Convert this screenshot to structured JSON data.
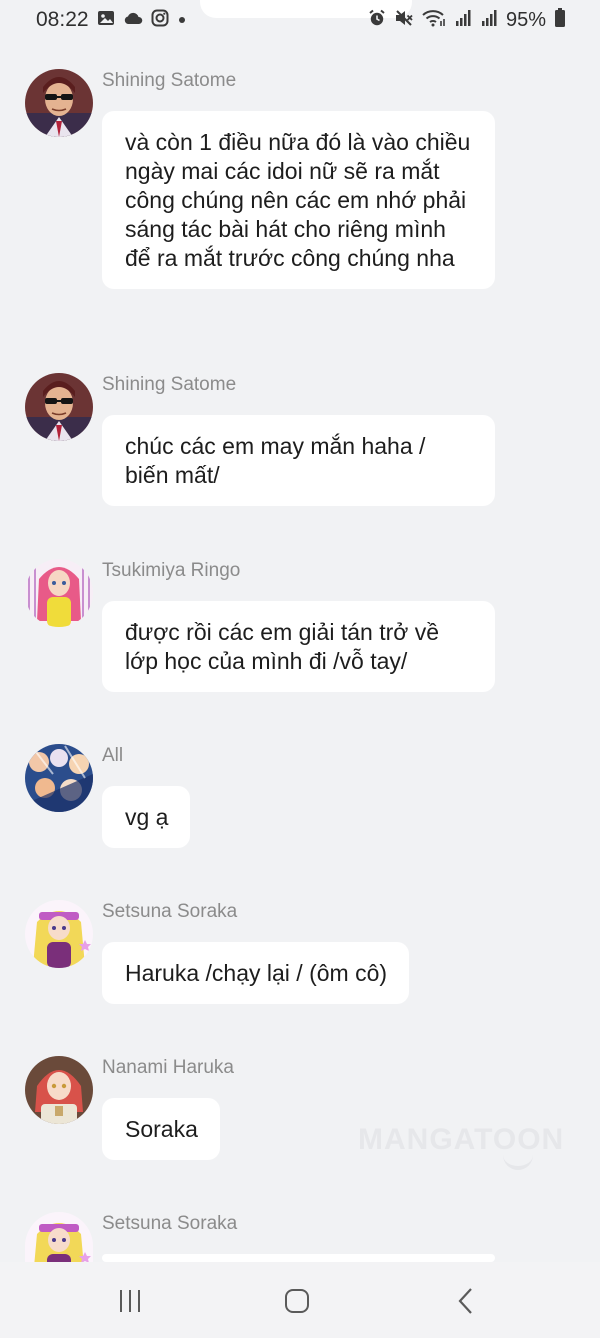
{
  "status_bar": {
    "time": "08:22",
    "left_icons": [
      "gallery-icon",
      "cloud-icon",
      "instagram-icon",
      "dot-icon"
    ],
    "right_icons": [
      "alarm-icon",
      "mute-icon",
      "wifi-icon",
      "signal-icon",
      "signal-icon"
    ],
    "battery": "95%"
  },
  "messages": [
    {
      "sender": "Shining Satome",
      "text": "và còn 1 điều nữa đó là vào chiều ngày mai các idoi nữ sẽ ra mắt công chúng nên các em nhớ phải sáng tác bài hát cho riêng mình để ra mắt trước công chúng nha"
    },
    {
      "sender": "Shining Satome",
      "text": "chúc các em may mắn haha / biến mất/"
    },
    {
      "sender": "Tsukimiya Ringo",
      "text": "được rồi các em giải tán trở về lớp học của mình đi /vỗ tay/"
    },
    {
      "sender": "All",
      "text": "vg ạ"
    },
    {
      "sender": "Setsuna Soraka",
      "text": "Haruka /chạy lại / (ôm cô)"
    },
    {
      "sender": "Nanami Haruka",
      "text": "Soraka"
    },
    {
      "sender": "Setsuna Soraka",
      "text": ""
    }
  ],
  "watermark": "MANGATOON",
  "nav": {
    "recent_apps": "recent-apps-icon",
    "home": "home-icon",
    "back": "back-icon"
  },
  "colors": {
    "background": "#f1f2f4",
    "bubble": "#ffffff",
    "sender_name": "#8b8b8b",
    "text": "#1d1d1d"
  }
}
